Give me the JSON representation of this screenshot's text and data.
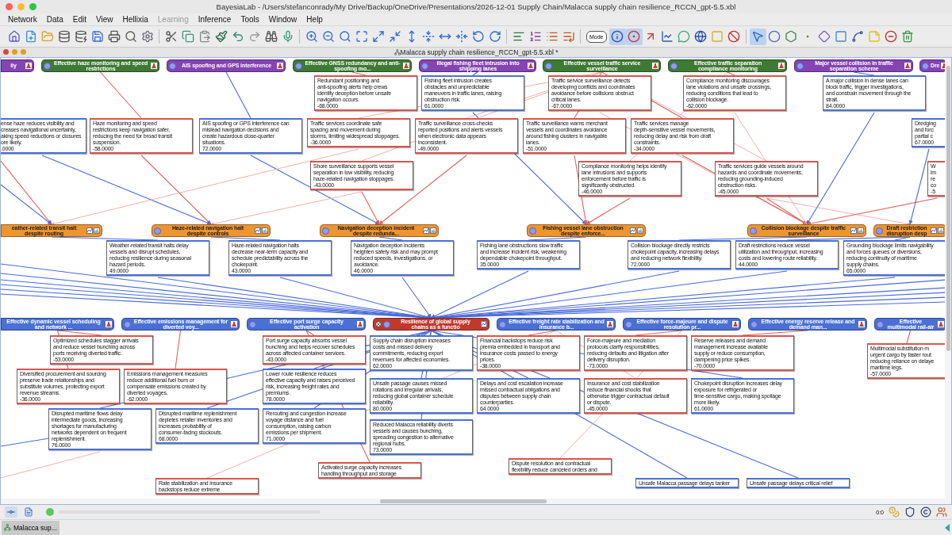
{
  "window": {
    "title": "BayesiaLab - /Users/stefanconrady/My Drive/Backup/OneDrive/Presentations/2026-12-01 Supply Chain/Malacca supply chain resilience_RCCN_gpt-5.5.xbl"
  },
  "menu": [
    {
      "label": "Network",
      "disabled": false
    },
    {
      "label": "Data",
      "disabled": false
    },
    {
      "label": "Edit",
      "disabled": false
    },
    {
      "label": "View",
      "disabled": false
    },
    {
      "label": "Hellixia",
      "disabled": false
    },
    {
      "label": "Learning",
      "disabled": true
    },
    {
      "label": "Inference",
      "disabled": false
    },
    {
      "label": "Tools",
      "disabled": false
    },
    {
      "label": "Window",
      "disabled": false
    },
    {
      "label": "Help",
      "disabled": false
    }
  ],
  "toolbar": [
    {
      "selected": false
    },
    {
      "selected": false
    },
    {
      "selected": false
    },
    {
      "selected": false
    },
    {
      "selected": false
    },
    {
      "selected": false
    },
    {
      "selected": false
    },
    {
      "selected": false
    },
    {
      "selected": false
    },
    {
      "selected": false
    },
    {
      "selected": false
    },
    {
      "selected": false
    },
    {
      "selected": false
    },
    {
      "selected": false
    },
    {
      "selected": false
    },
    {
      "selected": false
    },
    {
      "selected": false
    },
    {
      "selected": false
    },
    {
      "selected": false
    },
    {
      "selected": false
    },
    {
      "selected": false
    },
    {
      "selected": false
    },
    {
      "selected": false
    },
    {
      "selected": false
    },
    {
      "selected": false
    },
    {
      "selected": false
    },
    {
      "selected": false
    },
    {
      "selected": false
    },
    {
      "selected": false
    },
    {
      "selected": false
    },
    {
      "selected": false
    },
    {
      "selected": false
    },
    {
      "selected": false
    },
    {
      "selected": false,
      "label": "Mode"
    },
    {
      "selected": true
    },
    {
      "selected": true
    },
    {
      "selected": false
    },
    {
      "selected": false
    },
    {
      "selected": false
    },
    {
      "selected": false
    },
    {
      "selected": false
    },
    {
      "selected": false
    },
    {
      "selected": true
    },
    {
      "selected": false
    },
    {
      "selected": false
    },
    {
      "selected": false
    },
    {
      "selected": false
    },
    {
      "selected": false
    },
    {
      "selected": false
    },
    {
      "selected": false
    },
    {
      "selected": false
    },
    {
      "selected": false
    }
  ],
  "document": {
    "title": "Malacca supply chain resilience_RCCN_gpt-5.5.xbl *"
  },
  "top_nodes": [
    {
      "label": "ily",
      "kind": "factor",
      "color": "#8544b3"
    },
    {
      "label": "Effective haze monitoring and speed restrictions",
      "kind": "factor",
      "color": "#3f7a34"
    },
    {
      "label": "AIS spoofing and GPS interference",
      "kind": "factor",
      "color": "#8544b3"
    },
    {
      "label": "Effective GNSS redundancy and anti-spoofing mo...",
      "kind": "factor",
      "color": "#3f7a34"
    },
    {
      "label": "Illegal fishing fleet intrusion into shipping lanes",
      "kind": "factor",
      "color": "#8544b3"
    },
    {
      "label": "Effective vessel traffic service surveillance",
      "kind": "factor",
      "color": "#3f7a34"
    },
    {
      "label": "Effective traffic separation compliance monitoring",
      "kind": "factor",
      "color": "#3f7a34"
    },
    {
      "label": "Major vessel collision in traffic separation scheme",
      "kind": "factor",
      "color": "#8544b3"
    },
    {
      "label": "Dre",
      "kind": "factor",
      "color": "#8544b3"
    }
  ],
  "outcome_nodes": [
    {
      "label": "eather-related transit halt despite routing",
      "kind": "outcome",
      "color": "#ee9530"
    },
    {
      "label": "Haze-related navigation halt despite controls",
      "kind": "outcome",
      "color": "#ee9530"
    },
    {
      "label": "Navigation deception incident despite redunda...",
      "kind": "outcome",
      "color": "#ee9530"
    },
    {
      "label": "Fishing vessel lane obstruction despite enforce...",
      "kind": "outcome",
      "color": "#ee9530"
    },
    {
      "label": "Collision blockage despite traffic surveillance",
      "kind": "outcome",
      "color": "#ee9530"
    },
    {
      "label": "Draft restriction disruption desp",
      "kind": "outcome",
      "color": "#ee9530"
    }
  ],
  "bottom_nodes": [
    {
      "label": "Effective dynamic vessel scheduling and network ...",
      "kind": "factor",
      "color": "#4a70d4"
    },
    {
      "label": "Effective emissions management for diverted voy...",
      "kind": "factor",
      "color": "#4a70d4"
    },
    {
      "label": "Effective port surge capacity activation",
      "kind": "factor",
      "color": "#4a70d4"
    },
    {
      "label": "Resilience of global supply chains as a functio",
      "kind": "target",
      "color": "#c0392f"
    },
    {
      "label": "Effective freight rate stabilization and insurance b...",
      "kind": "factor",
      "color": "#4a70d4"
    },
    {
      "label": "Effective force-majeure and dispute resolution pr...",
      "kind": "factor",
      "color": "#4a70d4"
    },
    {
      "label": "Effective energy reserve release and demand man...",
      "kind": "factor",
      "color": "#4a70d4"
    },
    {
      "label": "Effective multimodal rail-air",
      "kind": "factor",
      "color": "#4a70d4"
    }
  ],
  "notes": [
    {
      "lines": [
        "ense haze reduces visibility and",
        "creases navigational uncertainty,",
        "aking speed reductions or closures",
        "ore likely."
      ],
      "value": ".0000",
      "color": "#4a70d4"
    },
    {
      "lines": [
        "Haze monitoring and speed",
        "restrictions keep navigation safer,",
        "reducing the need for broad transit",
        "suspension."
      ],
      "value": "-58.0000",
      "color": "#d9534f"
    },
    {
      "lines": [
        "AIS spoofing or GPS interference can",
        "mislead navigation decisions and",
        "create hazardous close-quarter",
        "situations."
      ],
      "value": "72.0000",
      "color": "#4a70d4"
    },
    {
      "lines": [
        "Redundant positioning and",
        "anti-spoofing alerts help crews",
        "identify deception before unsafe",
        "navigation occurs."
      ],
      "value": "-68.0000",
      "color": "#d9534f"
    },
    {
      "lines": [
        "Traffic services coordinate safe",
        "spacing and movement during",
        "storms, limiting widespread stoppages."
      ],
      "value": "-36.0000",
      "color": "#d9534f"
    },
    {
      "lines": [
        "Shore surveillance supports vessel",
        "separation in low visibility, reducing",
        "haze-related navigation stoppages."
      ],
      "value": "-43.0000",
      "color": "#d9534f"
    },
    {
      "lines": [
        "Fishing fleet intrusion creates",
        "obstacles and unpredictable",
        "maneuvers in traffic lanes, raising",
        "obstruction risk."
      ],
      "value": "61.0000",
      "color": "#4a70d4"
    },
    {
      "lines": [
        "Traffic surveillance cross-checks",
        "reported positions and alerts vessels",
        "when electronic data appears",
        "inconsistent."
      ],
      "value": "-49.0000",
      "color": "#d9534f"
    },
    {
      "lines": [
        "Traffic service surveillance detects",
        "developing conflicts and coordinates",
        "avoidance before collisions obstruct",
        "critical lanes."
      ],
      "value": "-67.0000",
      "color": "#d9534f"
    },
    {
      "lines": [
        "Traffic surveillance warns merchant",
        "vessels and coordinates avoidance",
        "around fishing clusters in navigable",
        "lanes."
      ],
      "value": "-51.0000",
      "color": "#d9534f"
    },
    {
      "lines": [
        "Compliance monitoring helps identify",
        "lane intrusions and supports",
        "enforcement before traffic is",
        "significantly obstructed."
      ],
      "value": "-46.0000",
      "color": "#d9534f"
    },
    {
      "lines": [
        "Compliance monitoring discourages",
        "lane violations and unsafe crossings,",
        "reducing conditions that lead to",
        "collision blockage."
      ],
      "value": "-62.0000",
      "color": "#d9534f"
    },
    {
      "lines": [
        "Traffic services manage",
        "depth-sensitive vessel movements,",
        "reducing delay and risk from draft",
        "constraints."
      ],
      "value": "-34.0000",
      "color": "#d9534f"
    },
    {
      "lines": [
        "Traffic services guide vessels around",
        "hazards and coordinate movements,",
        "reducing grounding-induced",
        "obstruction risks."
      ],
      "value": "-45.0000",
      "color": "#d9534f"
    },
    {
      "lines": [
        "A major collision in dense lanes can",
        "block traffic, trigger investigations,",
        "and constrain movement through the",
        "strait."
      ],
      "value": "84.0000",
      "color": "#4a70d4"
    },
    {
      "lines": [
        "Dredging",
        "and forc",
        "partial c"
      ],
      "value": "67.0000",
      "color": "#4a70d4"
    },
    {
      "lines": [
        "W",
        "im",
        "re",
        "co"
      ],
      "value": "-5",
      "color": "#d9534f"
    },
    {
      "lines": [
        "Weather-related transit halts delay",
        "vessels and disrupt schedules,",
        "reducing resilience during seasonal",
        "hazard periods."
      ],
      "value": "49.0000",
      "color": "#4a70d4"
    },
    {
      "lines": [
        "Haze-related navigation halts",
        "decrease near-term capacity and",
        "schedule predictability across the",
        "chokepoint."
      ],
      "value": "43.0000",
      "color": "#4a70d4"
    },
    {
      "lines": [
        "Navigation deception incidents",
        "heighten safety risk and may prompt",
        "reduced speeds, investigations, or",
        "avoidance."
      ],
      "value": "46.0000",
      "color": "#4a70d4"
    },
    {
      "lines": [
        "Fishing lane obstructions slow traffic",
        "and increase incident risk, weakening",
        "dependable chokepoint throughput."
      ],
      "value": "35.0000",
      "color": "#4a70d4"
    },
    {
      "lines": [
        "Collision blockage directly restricts",
        "chokepoint capacity, increasing delays",
        "and reducing network flexibility."
      ],
      "value": "72.0000",
      "color": "#4a70d4"
    },
    {
      "lines": [
        "Draft restrictions reduce vessel",
        "utilization and throughput, increasing",
        "costs and lowering route reliability."
      ],
      "value": "44.0000",
      "color": "#4a70d4"
    },
    {
      "lines": [
        "Grounding blockage limits navigability",
        "and forces queues or diversions,",
        "reducing continuity of maritime",
        "supply chains."
      ],
      "value": "65.0000",
      "color": "#4a70d4"
    },
    {
      "lines": [
        "Optimized schedules stagger arrivals",
        "and reduce vessel bunching across",
        "ports receiving diverted traffic."
      ],
      "value": "-53.0000",
      "color": "#d9534f"
    },
    {
      "lines": [
        "Diversified procurement and sourcing",
        "preserve trade relationships and",
        "substitute volumes, protecting export",
        "revenue streams."
      ],
      "value": "-36.0000",
      "color": "#d9534f"
    },
    {
      "lines": [
        "Emissions management measures",
        "reduce additional fuel burn or",
        "compensate emissions created by",
        "diverted voyages."
      ],
      "value": "-62.0000",
      "color": "#d9534f"
    },
    {
      "lines": [
        "Disrupted maritime flows delay",
        "intermediate goods, increasing",
        "shortages for manufacturing",
        "networks dependent on frequent",
        "replenishment."
      ],
      "value": "76.0000",
      "color": "#4a70d4"
    },
    {
      "lines": [
        "Disrupted maritime replenishment",
        "depletes retailer inventories and",
        "increases probability of",
        "consumer-facing stockouts."
      ],
      "value": "68.0000",
      "color": "#4a70d4"
    },
    {
      "lines": [
        "Rate stabilization and insurance",
        "backstops reduce extreme"
      ],
      "color": "#d9534f"
    },
    {
      "lines": [
        "Port surge capacity absorbs vessel",
        "bunching and helps recover schedules",
        "across affected container services."
      ],
      "value": "-43.0000",
      "color": "#d9534f"
    },
    {
      "lines": [
        "Lower route resilience reduces",
        "effective capacity and raises perceived",
        "risk, increasing freight rates and",
        "premiums."
      ],
      "value": "78.0000",
      "color": "#4a70d4"
    },
    {
      "lines": [
        "Rerouting and congestion increase",
        "voyage distance and fuel",
        "consumption, raising carbon",
        "emissions per shipment."
      ],
      "value": "71.0000",
      "color": "#4a70d4"
    },
    {
      "lines": [
        "Supply chain disruption increases",
        "costs and missed delivery",
        "commitments, reducing export",
        "revenues for affected economies."
      ],
      "value": "62.0000",
      "color": "#4a70d4"
    },
    {
      "lines": [
        "Unsafe passage causes missed",
        "rotations and irregular arrivals,",
        "reducing global container schedule",
        "reliability."
      ],
      "value": "80.0000",
      "color": "#4a70d4"
    },
    {
      "lines": [
        "Reduced Malacca reliability diverts",
        "vessels and causes bunching,",
        "spreading congestion to alternative",
        "regional hubs."
      ],
      "value": "73.0000",
      "color": "#4a70d4"
    },
    {
      "lines": [
        "Activated surge capacity increases",
        "handling throughput and storage"
      ],
      "color": "#d9534f"
    },
    {
      "lines": [
        "Financial backstops reduce risk",
        "premia embedded in transport and",
        "insurance costs passed to energy",
        "prices."
      ],
      "value": "-38.0000",
      "color": "#d9534f"
    },
    {
      "lines": [
        "Delays and cost escalation increase",
        "missed contractual obligations and",
        "disputes between supply chain",
        "counterparties."
      ],
      "value": "64.0000",
      "color": "#4a70d4"
    },
    {
      "lines": [
        "Force-majeure and mediation",
        "protocols clarify responsibilities,",
        "reducing defaults and litigation after",
        "delivery disruption."
      ],
      "value": "-73.0000",
      "color": "#d9534f"
    },
    {
      "lines": [
        "Insurance and cost stabilization",
        "reduce financial shocks that",
        "otherwise trigger contractual default",
        "or dispute."
      ],
      "value": "-45.0000",
      "color": "#d9534f"
    },
    {
      "lines": [
        "Reserve releases and demand",
        "management increase available",
        "supply or reduce consumption,",
        "dampening price spikes."
      ],
      "value": "-70.0000",
      "color": "#d9534f"
    },
    {
      "lines": [
        "Chokepoint disruption increases delay",
        "exposure for refrigerated or",
        "time-sensitive cargo, making spoilage",
        "more likely."
      ],
      "value": "61.0000",
      "color": "#4a70d4"
    },
    {
      "lines": [
        "Multimodal substitution m",
        "urgent cargo by faster rout",
        "reducing reliance on delaye",
        "maritime legs."
      ],
      "value": "-57.0000",
      "color": "#d9534f"
    },
    {
      "lines": [
        "Dispute resolution and contractual",
        "flexibility reduce canceled orders and"
      ],
      "color": "#d9534f"
    },
    {
      "lines": [
        "Unsafe Malacca passage delays tanker"
      ],
      "color": "#4a70d4"
    },
    {
      "lines": [
        "Unsafe passage delays critical relief"
      ],
      "color": "#4a70d4"
    }
  ],
  "status_bar": {
    "level": 0,
    "modes": [
      {
        "selected": true
      },
      {
        "selected": false
      }
    ],
    "clock": "0:0"
  },
  "taskbar": {
    "tab": "Malacca sup..."
  }
}
